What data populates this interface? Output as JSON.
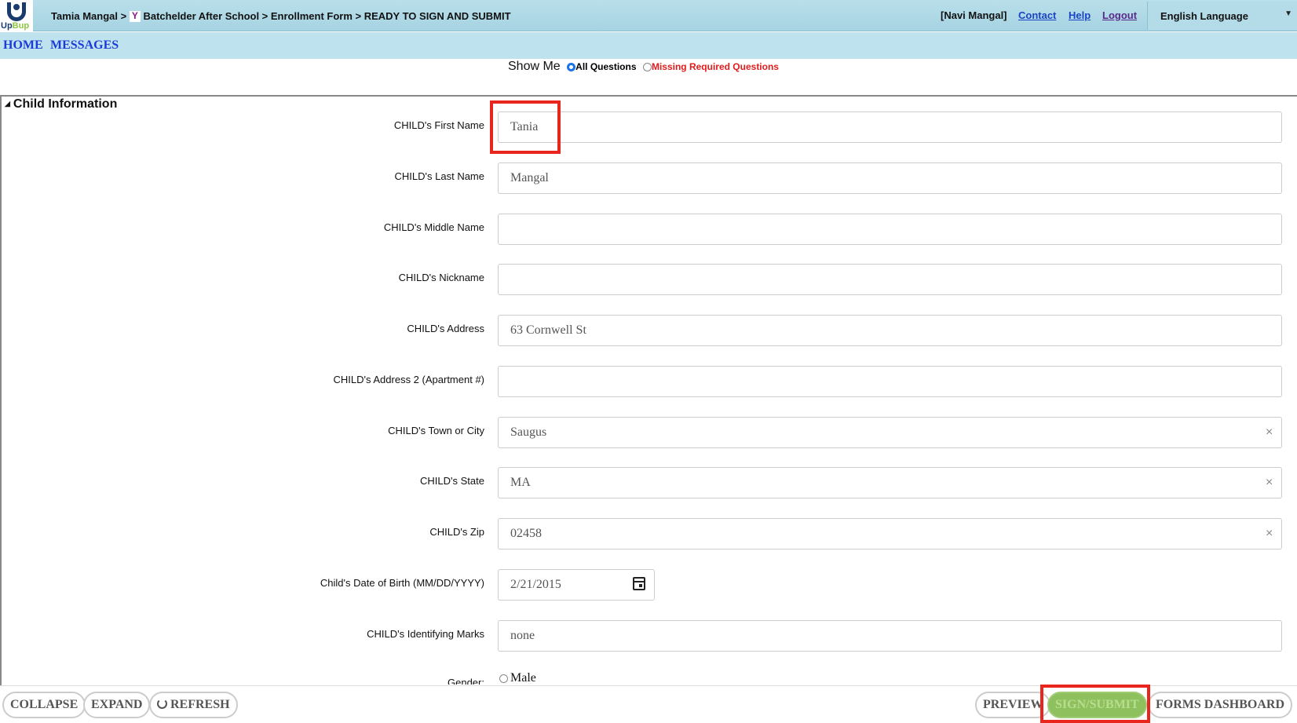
{
  "header": {
    "logo_text_a": "Up",
    "logo_text_b": "Bup",
    "breadcrumb_user": "Tamia Mangal >",
    "breadcrumb_org": "Batchelder After School > Enrollment Form > READY TO SIGN AND SUBMIT",
    "org_icon": "Y",
    "user": "[Navi Mangal]",
    "contact": "Contact",
    "help": "Help",
    "logout": "Logout",
    "language": "English Language"
  },
  "nav": {
    "home": "HOME",
    "messages": "MESSAGES"
  },
  "show_me": {
    "title": "Show Me",
    "all": "All Questions",
    "missing": "Missing Required Questions",
    "selected": "All Questions"
  },
  "section": {
    "title": "Child Information"
  },
  "fields": {
    "first_name": {
      "label": "CHILD's First Name",
      "value": "Tania"
    },
    "last_name": {
      "label": "CHILD's Last Name",
      "value": "Mangal"
    },
    "middle_name": {
      "label": "CHILD's Middle Name",
      "value": ""
    },
    "nickname": {
      "label": "CHILD's Nickname",
      "value": ""
    },
    "address": {
      "label": "CHILD's Address",
      "value": "63 Cornwell St"
    },
    "address2": {
      "label": "CHILD's Address 2 (Apartment #)",
      "value": ""
    },
    "town": {
      "label": "CHILD's Town or City",
      "value": "Saugus"
    },
    "state": {
      "label": "CHILD's State",
      "value": "MA"
    },
    "zip": {
      "label": "CHILD's Zip",
      "value": "02458"
    },
    "dob": {
      "label": "Child's Date of Birth (MM/DD/YYYY)",
      "value": "2/21/2015"
    },
    "marks": {
      "label": "CHILD's Identifying Marks",
      "value": "none"
    },
    "gender": {
      "label": "Gender:",
      "option_male": "Male"
    }
  },
  "clear_glyph": "×",
  "bottom": {
    "collapse": "COLLAPSE",
    "expand": "EXPAND",
    "refresh": "REFRESH",
    "preview": "PREVIEW",
    "sign_submit": "SIGN/SUBMIT",
    "forms_dashboard": "FORMS DASHBOARD"
  },
  "colors": {
    "header_bg": "#a6d3e2",
    "nav_link": "#1a3bd8",
    "highlight": "#e8261d",
    "submit_bg": "#8ec15e",
    "missing_red": "#e31b1b"
  }
}
